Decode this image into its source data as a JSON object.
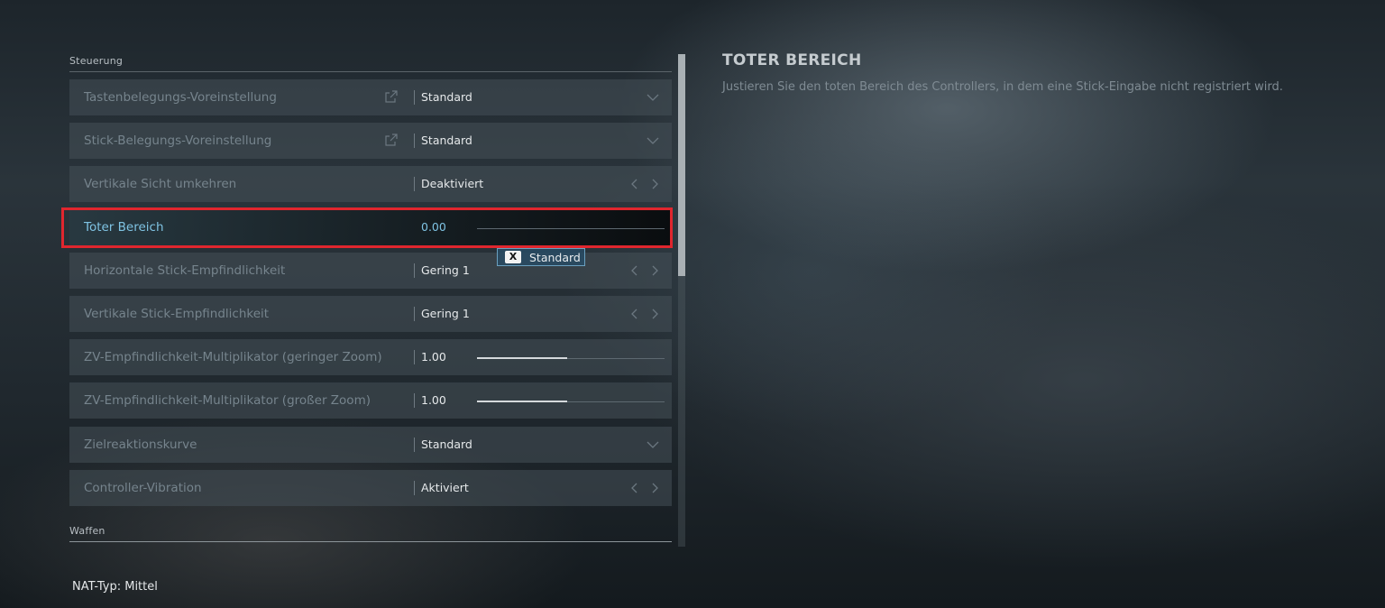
{
  "sections": {
    "controls": "Steuerung",
    "weapons": "Waffen"
  },
  "rows": [
    {
      "label": "Tastenbelegungs-Voreinstellung",
      "value": "Standard",
      "control": "dropdown",
      "external": true
    },
    {
      "label": "Stick-Belegungs-Voreinstellung",
      "value": "Standard",
      "control": "dropdown",
      "external": true
    },
    {
      "label": "Vertikale Sicht umkehren",
      "value": "Deaktiviert",
      "control": "arrows"
    },
    {
      "label": "Toter Bereich",
      "value": "0.00",
      "control": "slider",
      "slider_fraction": 0.0,
      "selected": true
    },
    {
      "label": "Horizontale Stick-Empfindlichkeit",
      "value": "Gering 1",
      "control": "arrows"
    },
    {
      "label": "Vertikale Stick-Empfindlichkeit",
      "value": "Gering 1",
      "control": "arrows"
    },
    {
      "label": "ZV-Empfindlichkeit-Multiplikator (geringer Zoom)",
      "value": "1.00",
      "control": "slider",
      "slider_fraction": 0.48
    },
    {
      "label": "ZV-Empfindlichkeit-Multiplikator (großer Zoom)",
      "value": "1.00",
      "control": "slider",
      "slider_fraction": 0.48
    },
    {
      "label": "Zielreaktionskurve",
      "value": "Standard",
      "control": "dropdown"
    },
    {
      "label": "Controller-Vibration",
      "value": "Aktiviert",
      "control": "arrows"
    }
  ],
  "tooltip": {
    "key": "X",
    "text": "Standard"
  },
  "info": {
    "title": "TOTER BEREICH",
    "description": "Justieren Sie den toten Bereich des Controllers, in dem eine Stick-Eingabe nicht registriert wird."
  },
  "footer": {
    "nat": "NAT-Typ: Mittel"
  },
  "colors": {
    "highlight": "#e0262e",
    "active_text": "#7fc3e3"
  }
}
